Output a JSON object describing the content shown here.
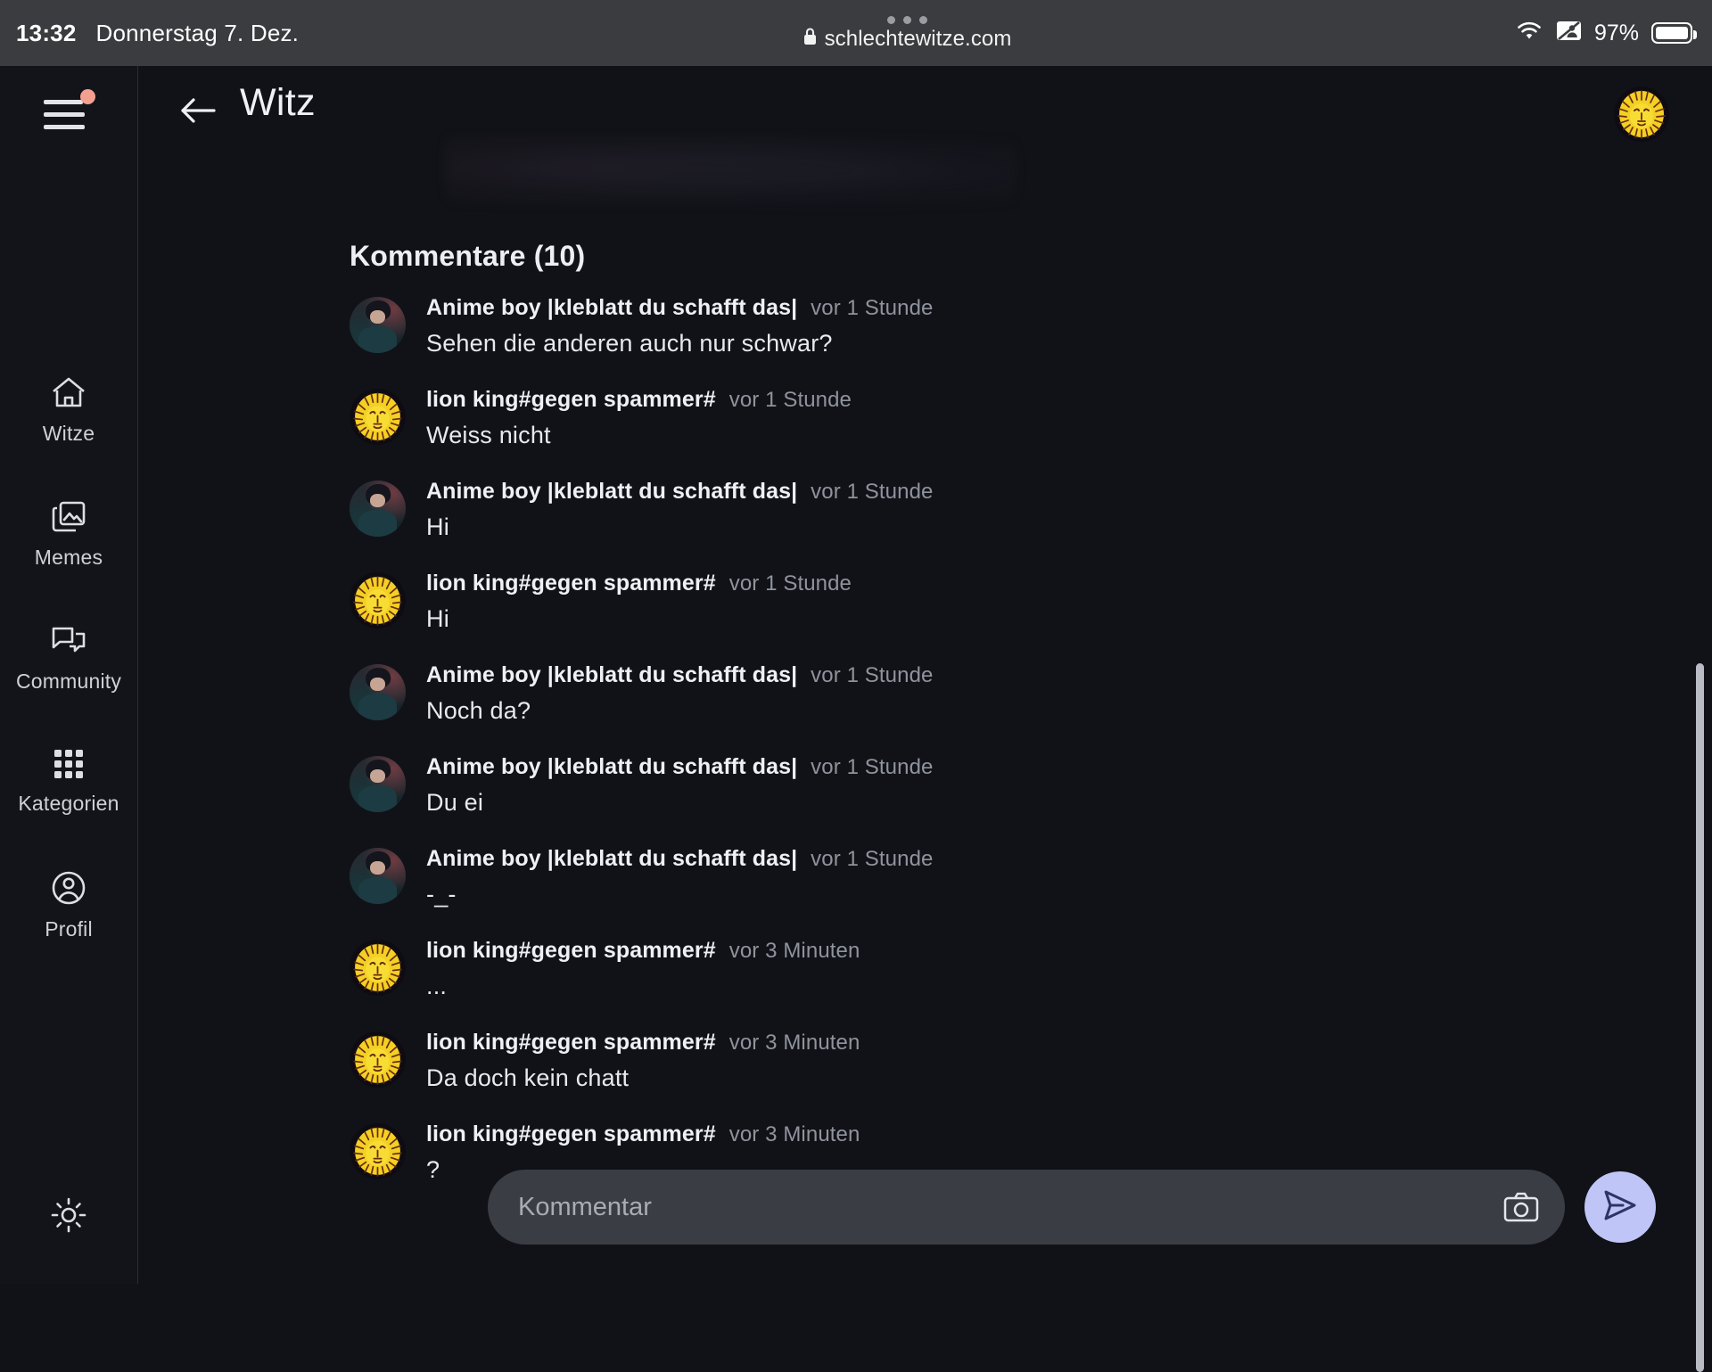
{
  "statusbar": {
    "time": "13:32",
    "date": "Donnerstag 7. Dez.",
    "url": "schlechtewitze.com",
    "lock_icon": "lock-icon",
    "wifi_icon": "wifi-icon",
    "screen_share_icon": "screen-share-icon",
    "battery_percent": "97%",
    "battery_icon": "battery-icon",
    "tab_dots": "tab-dots-icon"
  },
  "sidebar": {
    "menu_icon": "hamburger-menu-icon",
    "notification_badge_color": "#f4a090",
    "theme_toggle_icon": "sun-brightness-icon",
    "items": [
      {
        "label": "Witze",
        "icon": "home-icon"
      },
      {
        "label": "Memes",
        "icon": "images-icon"
      },
      {
        "label": "Community",
        "icon": "chat-bubbles-icon"
      },
      {
        "label": "Kategorien",
        "icon": "grid-icon"
      },
      {
        "label": "Profil",
        "icon": "user-circle-icon"
      }
    ]
  },
  "header": {
    "back_icon": "back-arrow-icon",
    "title": "Witz",
    "avatar": "lion-king-avatar"
  },
  "main": {
    "comments_heading": "Kommentare (10)",
    "comments": [
      {
        "user": "Anime boy |kleblatt du schafft das|",
        "time": "vor 1 Stunde",
        "text": "Sehen die anderen auch nur schwar?",
        "avatar": "anime"
      },
      {
        "user": "lion king#gegen spammer#",
        "time": "vor 1 Stunde",
        "text": "Weiss nicht",
        "avatar": "lion"
      },
      {
        "user": "Anime boy |kleblatt du schafft das|",
        "time": "vor 1 Stunde",
        "text": "Hi",
        "avatar": "anime"
      },
      {
        "user": "lion king#gegen spammer#",
        "time": "vor 1 Stunde",
        "text": "Hi",
        "avatar": "lion"
      },
      {
        "user": "Anime boy |kleblatt du schafft das|",
        "time": "vor 1 Stunde",
        "text": "Noch da?",
        "avatar": "anime"
      },
      {
        "user": "Anime boy |kleblatt du schafft das|",
        "time": "vor 1 Stunde",
        "text": "Du ei",
        "avatar": "anime"
      },
      {
        "user": "Anime boy |kleblatt du schafft das|",
        "time": "vor 1 Stunde",
        "text": "-_-",
        "avatar": "anime"
      },
      {
        "user": "lion king#gegen spammer#",
        "time": "vor 3 Minuten",
        "text": "...",
        "avatar": "lion"
      },
      {
        "user": "lion king#gegen spammer#",
        "time": "vor 3 Minuten",
        "text": "Da doch kein chatt",
        "avatar": "lion"
      },
      {
        "user": "lion king#gegen spammer#",
        "time": "vor 3 Minuten",
        "text": "?",
        "avatar": "lion"
      }
    ],
    "comment_menu_icon": "more-vertical-icon"
  },
  "composer": {
    "placeholder": "Kommentar",
    "value": "",
    "camera_icon": "camera-icon",
    "send_icon": "send-paper-plane-icon",
    "send_button_color": "#bfc6f7"
  },
  "colors": {
    "page_background": "#111218",
    "sidebar_background": "#13141a",
    "statusbar_background": "#3a3c3f",
    "input_background": "#3b3d44",
    "accent": "#bfc6f7",
    "notification": "#f4a090"
  }
}
